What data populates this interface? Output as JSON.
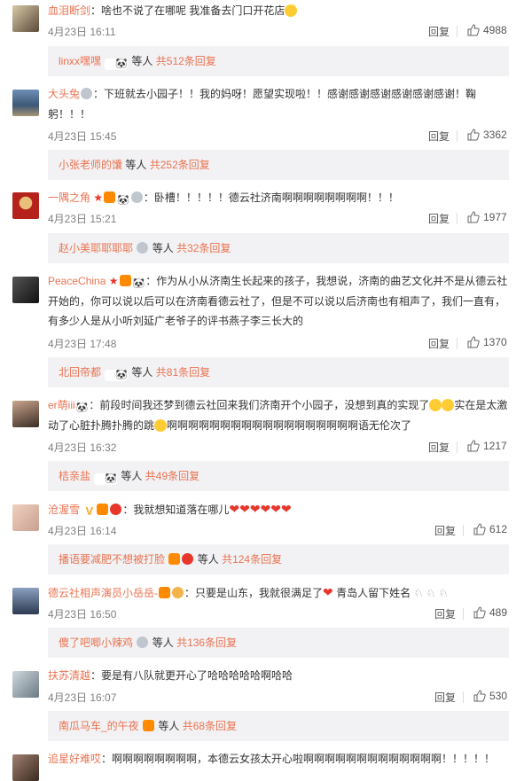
{
  "comments": [
    {
      "username": "血泪断剑",
      "text": "：啥也不说了在哪呢 我准备去门口开花店",
      "time": "4月23日 16:11",
      "reply": "回复",
      "likes": "4988",
      "sub": {
        "names": "linxx嘿嘿",
        "suffix": "等人",
        "count": "共512条回复"
      }
    },
    {
      "username": "大头兔",
      "text": "：下班就去小园子！！我的妈呀！愿望实现啦！！感谢感谢感谢感谢感谢感谢！鞠躬！！！",
      "time": "4月23日 15:45",
      "reply": "回复",
      "likes": "3362",
      "sub": {
        "names": "小张老师的馕",
        "suffix": "等人",
        "count": "共252条回复"
      }
    },
    {
      "username": "一隅之角",
      "text": "：卧槽！！！！！德云社济南啊啊啊啊啊啊啊啊！！！",
      "time": "4月23日 15:21",
      "reply": "回复",
      "likes": "1977",
      "sub": {
        "names": "赵小美耶耶耶耶",
        "suffix": "等人",
        "count": "共32条回复"
      }
    },
    {
      "username": "PeaceChina",
      "text": "：作为从小从济南生长起来的孩子，我想说，济南的曲艺文化并不是从德云社开始的，你可以说以后可以在济南看德云社了，但是不可以说以后济南也有相声了，我们一直有，有多少人是从小听刘延广老爷子的评书燕子李三长大的",
      "time": "4月23日 17:48",
      "reply": "回复",
      "likes": "1370",
      "sub": {
        "names": "北回帝都",
        "suffix": "等人",
        "count": "共81条回复"
      }
    },
    {
      "username": "er萌iii",
      "text": "：前段时间我还梦到德云社回来我们济南开个小园子，没想到真的实现了",
      "text2": "实在是太激动了心脏扑腾扑腾的跳",
      "text3": "啊啊啊啊啊啊啊啊啊啊啊啊啊啊啊啊啊啊语无伦次了",
      "time": "4月23日 16:32",
      "reply": "回复",
      "likes": "1217",
      "sub": {
        "names": "桔亲盐",
        "suffix": "等人",
        "count": "共49条回复"
      }
    },
    {
      "username": "沧渥雪",
      "text": "：我就想知道落在哪儿",
      "time": "4月23日 16:14",
      "reply": "回复",
      "likes": "612",
      "sub": {
        "names": "播语要减肥不想被打脸",
        "suffix": "等人",
        "count": "共124条回复"
      }
    },
    {
      "username": "德云社相声演员小岳岳-",
      "text": "：只要是山东，我就很满足了",
      "text2": " 青岛人留下姓名",
      "time": "4月23日 16:50",
      "reply": "回复",
      "likes": "489",
      "sub": {
        "names": "傻了吧唧小辣鸡",
        "suffix": "等人",
        "count": "共136条回复"
      }
    },
    {
      "username": "扶苏清越",
      "text": "：要是有八队就更开心了哈哈哈哈哈啊哈哈",
      "time": "4月23日 16:07",
      "reply": "回复",
      "likes": "530",
      "sub": {
        "names": "南瓜马车_的午夜",
        "suffix": "等人",
        "count": "共68条回复"
      }
    },
    {
      "username": "追星好难哎",
      "text": "：啊啊啊啊啊啊啊啊，本德云女孩太开心啦啊啊啊啊啊啊啊啊啊啊啊啊啊！！！！！"
    }
  ],
  "colors": {
    "username": "#eb7350",
    "text": "#333333",
    "meta": "#808080",
    "subbg": "#f2f2f5"
  }
}
